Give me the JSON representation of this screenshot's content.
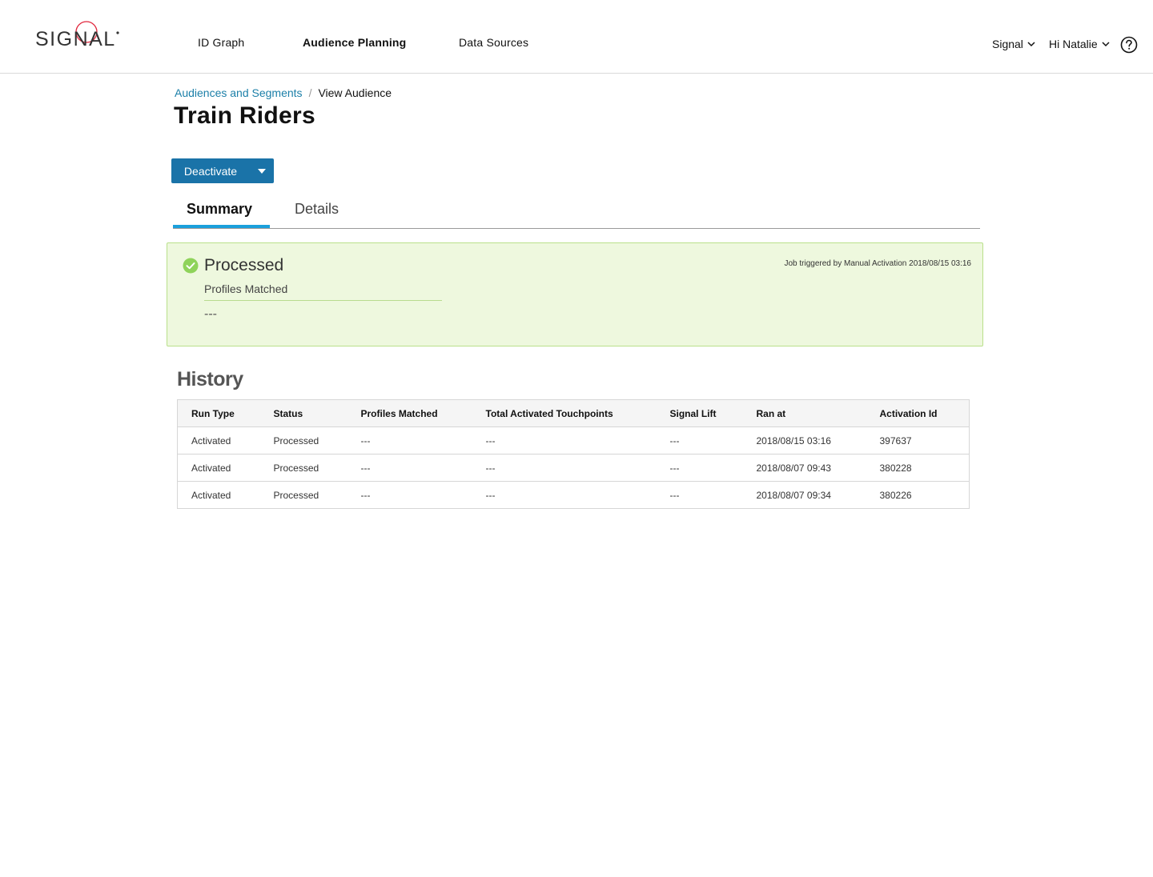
{
  "header": {
    "logo_text": "SIGNAL",
    "nav": [
      {
        "label": "ID Graph",
        "active": false
      },
      {
        "label": "Audience Planning",
        "active": true
      },
      {
        "label": "Data Sources",
        "active": false
      }
    ],
    "org_menu_label": "Signal",
    "user_menu_label": "Hi Natalie",
    "help_icon": "question-circle-icon"
  },
  "breadcrumb": {
    "parent": "Audiences and Segments",
    "separator": "/",
    "current": "View Audience"
  },
  "page": {
    "title": "Train Riders"
  },
  "actions": {
    "primary_label": "Deactivate",
    "caret_icon": "caret-down-icon",
    "accent_color": "#1a73a8"
  },
  "tabs": [
    {
      "label": "Summary",
      "active": true
    },
    {
      "label": "Details",
      "active": false
    }
  ],
  "status_card": {
    "status": "Processed",
    "status_icon": "check-circle-icon",
    "status_color": "#8fd35a",
    "job_note": "Job triggered by Manual Activation 2018/08/15 03:16",
    "metric_label": "Profiles Matched",
    "metric_value": "---"
  },
  "history": {
    "title": "History",
    "columns": [
      "Run Type",
      "Status",
      "Profiles Matched",
      "Total Activated Touchpoints",
      "Signal Lift",
      "Ran at",
      "Activation Id"
    ],
    "rows": [
      [
        "Activated",
        "Processed",
        "---",
        "---",
        "---",
        "2018/08/15 03:16",
        "397637"
      ],
      [
        "Activated",
        "Processed",
        "---",
        "---",
        "---",
        "2018/08/07 09:43",
        "380228"
      ],
      [
        "Activated",
        "Processed",
        "---",
        "---",
        "---",
        "2018/08/07 09:34",
        "380226"
      ]
    ]
  }
}
